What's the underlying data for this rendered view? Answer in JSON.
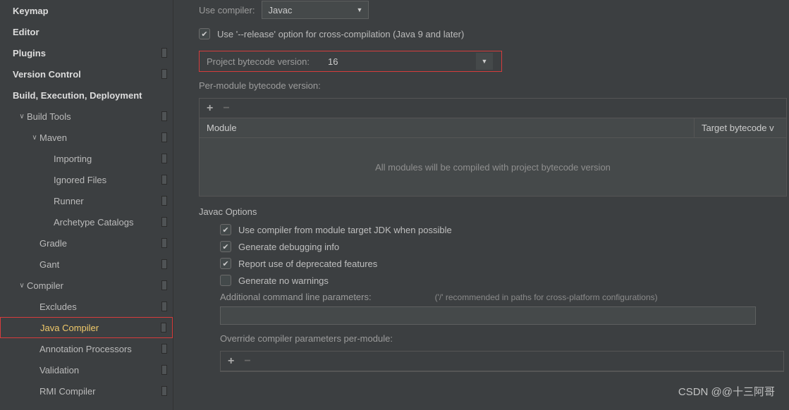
{
  "sidebar": {
    "items": [
      {
        "label": "Keymap",
        "bold": true,
        "indent": 0,
        "arrow": "",
        "bar": false
      },
      {
        "label": "Editor",
        "bold": true,
        "indent": 0,
        "arrow": "",
        "bar": false
      },
      {
        "label": "Plugins",
        "bold": true,
        "indent": 0,
        "arrow": "",
        "bar": true
      },
      {
        "label": "Version Control",
        "bold": true,
        "indent": 0,
        "arrow": "",
        "bar": true
      },
      {
        "label": "Build, Execution, Deployment",
        "bold": true,
        "indent": 0,
        "arrow": "",
        "bar": false
      },
      {
        "label": "Build Tools",
        "bold": false,
        "indent": 1,
        "arrow": "v",
        "bar": true
      },
      {
        "label": "Maven",
        "bold": false,
        "indent": 2,
        "arrow": "v",
        "bar": true
      },
      {
        "label": "Importing",
        "bold": false,
        "indent": 3,
        "arrow": "",
        "bar": true
      },
      {
        "label": "Ignored Files",
        "bold": false,
        "indent": 3,
        "arrow": "",
        "bar": true
      },
      {
        "label": "Runner",
        "bold": false,
        "indent": 3,
        "arrow": "",
        "bar": true
      },
      {
        "label": "Archetype Catalogs",
        "bold": false,
        "indent": 3,
        "arrow": "",
        "bar": true
      },
      {
        "label": "Gradle",
        "bold": false,
        "indent": 2,
        "arrow": "",
        "bar": true
      },
      {
        "label": "Gant",
        "bold": false,
        "indent": 2,
        "arrow": "",
        "bar": true
      },
      {
        "label": "Compiler",
        "bold": false,
        "indent": 1,
        "arrow": "v",
        "bar": true
      },
      {
        "label": "Excludes",
        "bold": false,
        "indent": 2,
        "arrow": "",
        "bar": true
      },
      {
        "label": "Java Compiler",
        "bold": false,
        "indent": 2,
        "arrow": "",
        "bar": true,
        "selected": true,
        "redbox": true
      },
      {
        "label": "Annotation Processors",
        "bold": false,
        "indent": 2,
        "arrow": "",
        "bar": true
      },
      {
        "label": "Validation",
        "bold": false,
        "indent": 2,
        "arrow": "",
        "bar": true
      },
      {
        "label": "RMI Compiler",
        "bold": false,
        "indent": 2,
        "arrow": "",
        "bar": true
      }
    ]
  },
  "main": {
    "use_compiler_label": "Use compiler:",
    "use_compiler_value": "Javac",
    "release_option": "Use '--release' option for cross-compilation (Java 9 and later)",
    "project_bytecode_label": "Project bytecode version:",
    "project_bytecode_value": "16",
    "per_module_label": "Per-module bytecode version:",
    "table": {
      "col_module": "Module",
      "col_target": "Target bytecode v",
      "empty_msg": "All modules will be compiled with project bytecode version"
    },
    "javac_options_title": "Javac Options",
    "opts": [
      {
        "label": "Use compiler from module target JDK when possible",
        "checked": true
      },
      {
        "label": "Generate debugging info",
        "checked": true
      },
      {
        "label": "Report use of deprecated features",
        "checked": true
      },
      {
        "label": "Generate no warnings",
        "checked": false
      }
    ],
    "addl_params_label": "Additional command line parameters:",
    "addl_params_hint": "('/' recommended in paths for cross-platform configurations)",
    "override_label": "Override compiler parameters per-module:"
  },
  "watermark": "CSDN @@十三阿哥"
}
